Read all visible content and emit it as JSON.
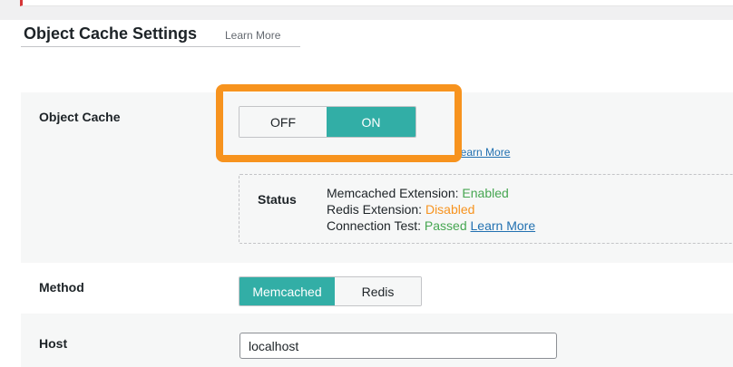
{
  "header": {
    "title": "Object Cache Settings",
    "learn_more": "Learn More"
  },
  "object_cache": {
    "label": "Object Cache",
    "off_label": "OFF",
    "on_label": "ON",
    "selected": "ON",
    "learn_more": "Learn More"
  },
  "status": {
    "label": "Status",
    "memcached_label": "Memcached Extension:",
    "memcached_value": "Enabled",
    "redis_label": "Redis Extension:",
    "redis_value": "Disabled",
    "connection_label": "Connection Test:",
    "connection_value": "Passed",
    "learn_more": "Learn More"
  },
  "method": {
    "label": "Method",
    "options": [
      "Memcached",
      "Redis"
    ],
    "selected": "Memcached"
  },
  "host": {
    "label": "Host",
    "value": "localhost"
  },
  "colors": {
    "accent": "#32aea6",
    "highlight": "#f7931e",
    "status_ok": "#46a651",
    "status_bad": "#f7931e",
    "link": "#2271b1"
  }
}
